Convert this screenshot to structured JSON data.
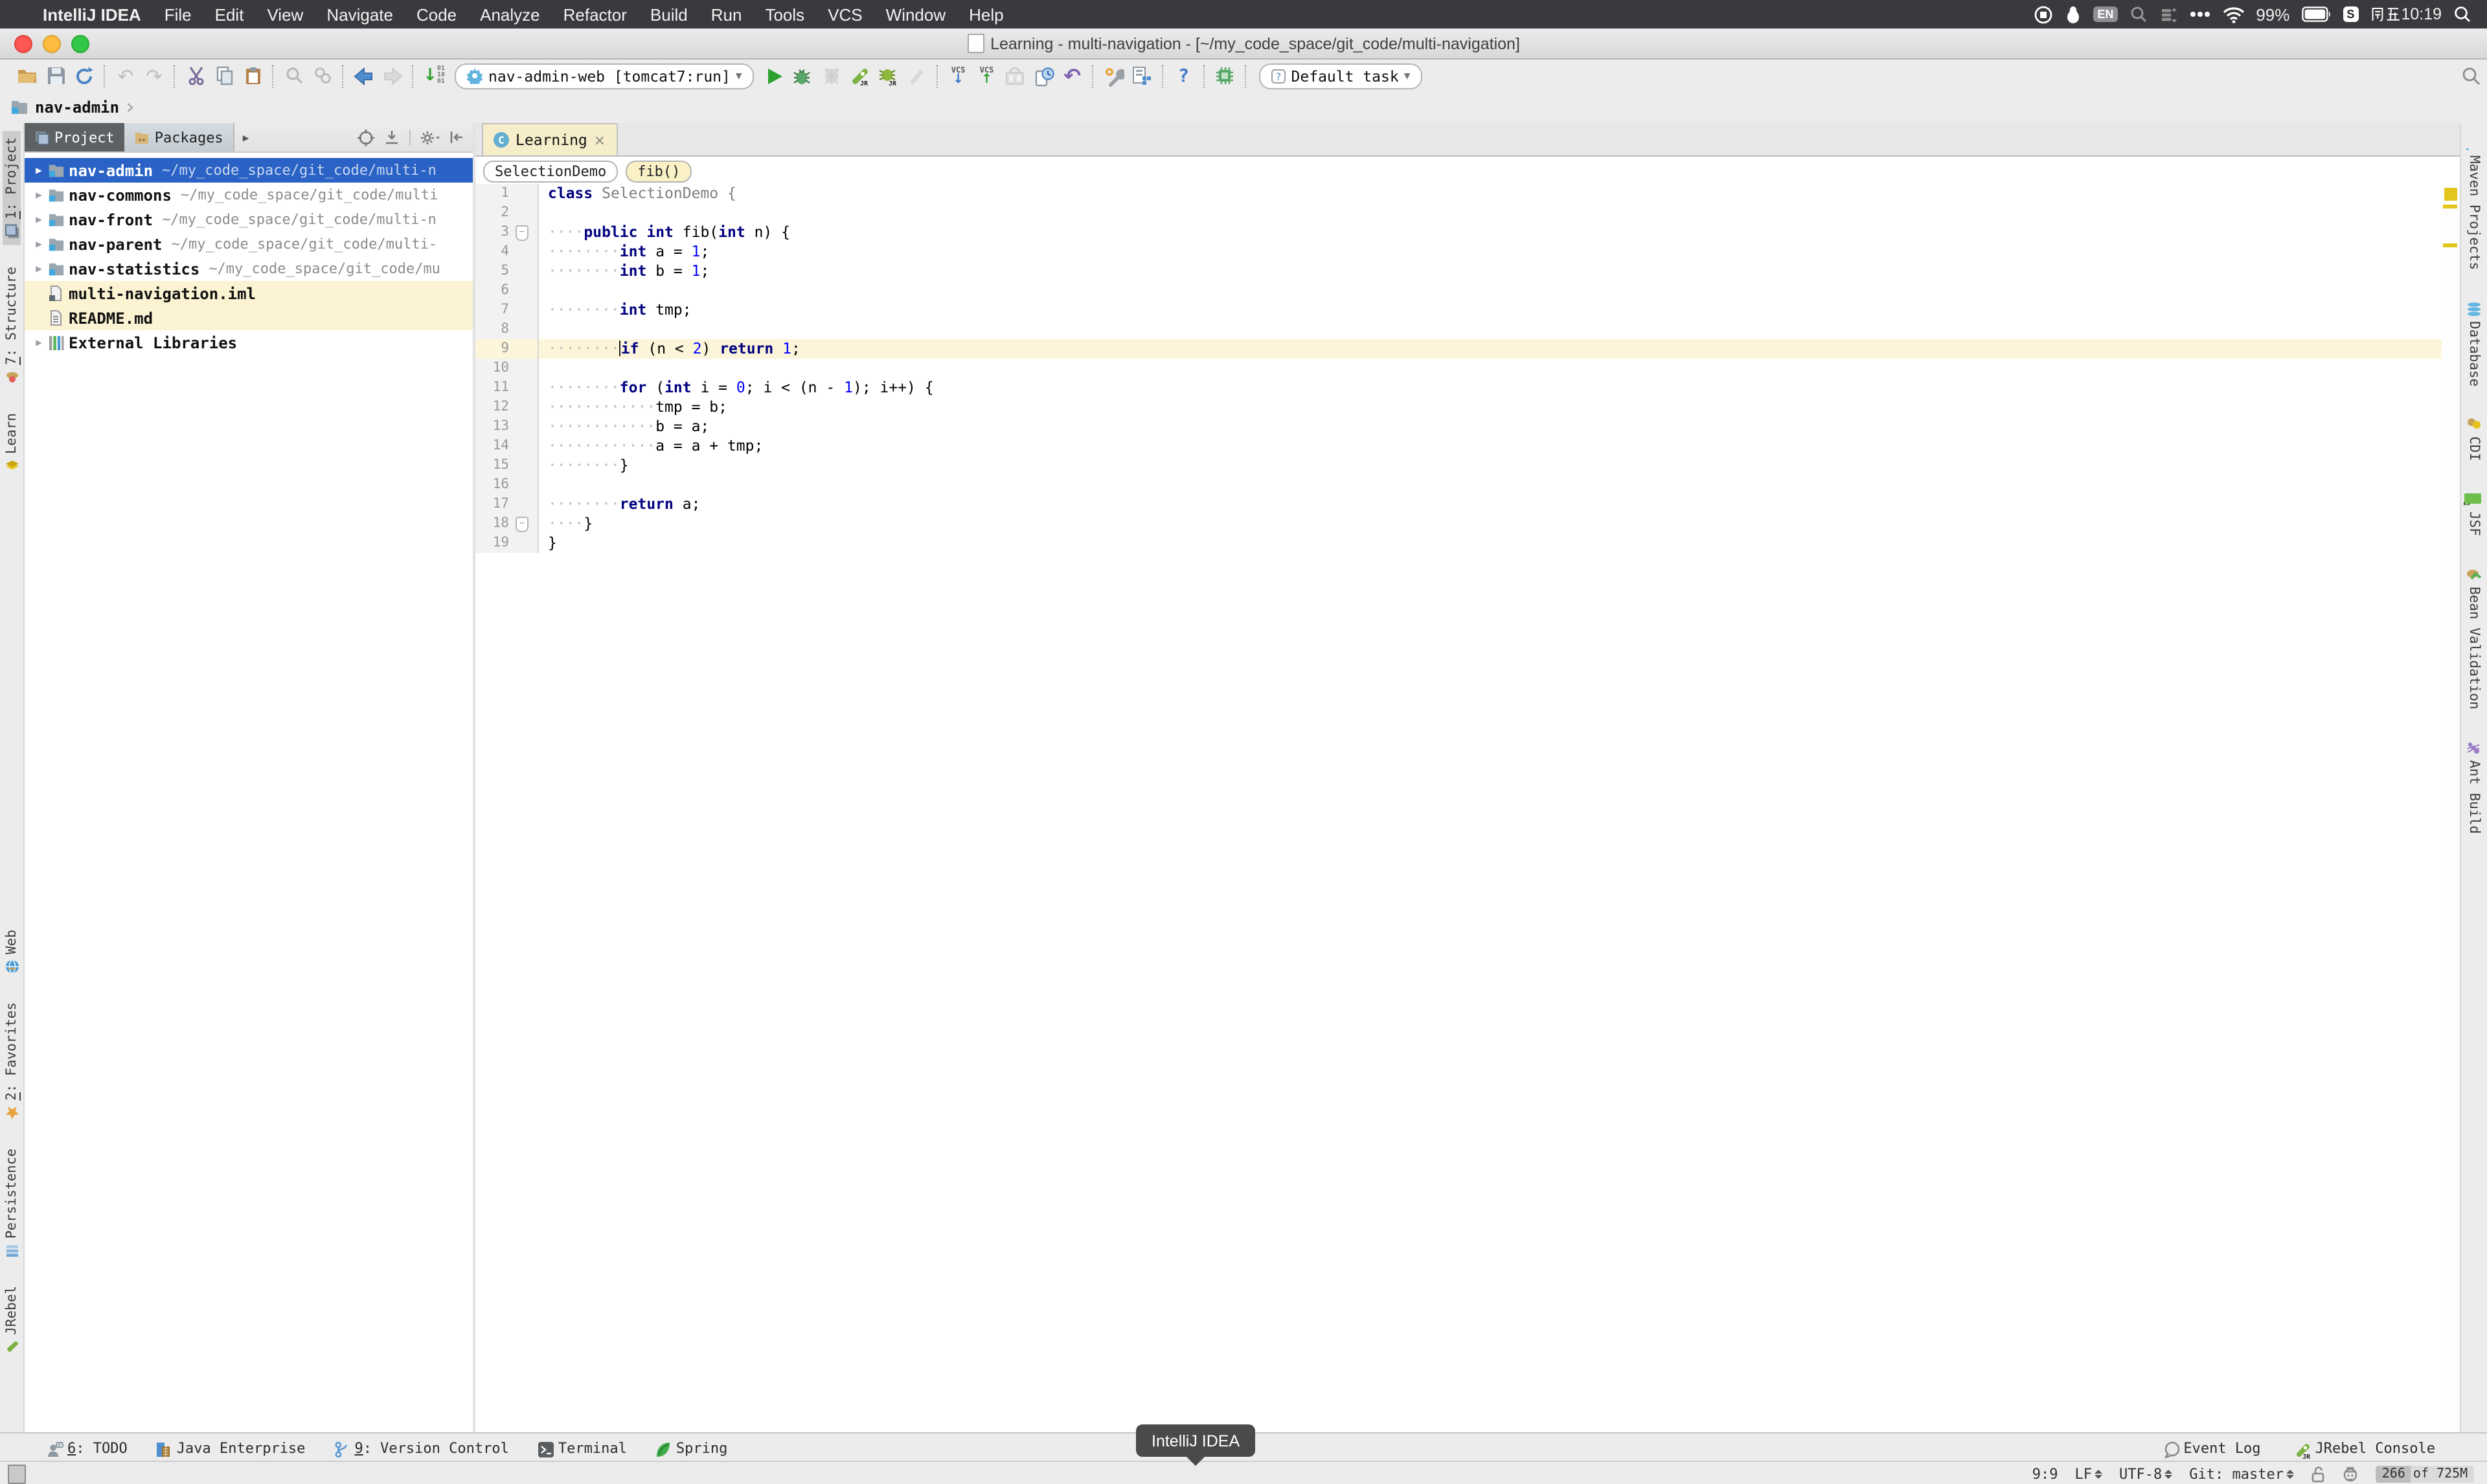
{
  "menubar": {
    "items": [
      "IntelliJ IDEA",
      "File",
      "Edit",
      "View",
      "Navigate",
      "Code",
      "Analyze",
      "Refactor",
      "Build",
      "Run",
      "Tools",
      "VCS",
      "Window",
      "Help"
    ],
    "status": {
      "input_badge": "EN",
      "ime_badge": "S",
      "battery": "99%",
      "clock_day": "周五",
      "clock_time": "10:19",
      "clock_full": "周五10:19"
    }
  },
  "titlebar": {
    "title": "Learning - multi-navigation - [~/my_code_space/git_code/multi-navigation]"
  },
  "toolbar": {
    "run_config": "nav-admin-web [tomcat7:run]",
    "task_config": "Default task",
    "help_label": "?"
  },
  "navbar": {
    "path": "nav-admin"
  },
  "left_stripe": {
    "top": [
      {
        "label": "1: Project",
        "icon": "project-icon",
        "active": true,
        "mnemonic": true
      },
      {
        "label": "7: Structure",
        "icon": "structure-icon",
        "active": false,
        "mnemonic": true
      },
      {
        "label": "Learn",
        "icon": "learn-icon",
        "active": false,
        "mnemonic": false
      }
    ],
    "bottom": [
      {
        "label": "Web",
        "icon": "web-icon",
        "active": false,
        "mnemonic": false
      },
      {
        "label": "2: Favorites",
        "icon": "favorites-icon",
        "active": false,
        "mnemonic": true
      },
      {
        "label": "Persistence",
        "icon": "persistence-icon",
        "active": false,
        "mnemonic": false
      },
      {
        "label": "JRebel",
        "icon": "jrebel-icon",
        "active": false,
        "mnemonic": false
      }
    ]
  },
  "right_stripe": {
    "items": [
      {
        "label": "Maven Projects",
        "icon": "maven-icon"
      },
      {
        "label": "Database",
        "icon": "database-icon"
      },
      {
        "label": "CDI",
        "icon": "cdi-icon"
      },
      {
        "label": "JSF",
        "icon": "jsf-icon"
      },
      {
        "label": "Bean Validation",
        "icon": "bean-icon"
      },
      {
        "label": "Ant Build",
        "icon": "ant-icon"
      }
    ]
  },
  "project_panel": {
    "tabs": {
      "project": "Project",
      "packages": "Packages"
    },
    "tree": [
      {
        "name": "nav-admin",
        "path": "~/my_code_space/git_code/multi-n",
        "icon": "module-folder",
        "arrow": true,
        "selected": true,
        "highlight": false
      },
      {
        "name": "nav-commons",
        "path": "~/my_code_space/git_code/multi",
        "icon": "module-folder",
        "arrow": true,
        "selected": false,
        "highlight": false
      },
      {
        "name": "nav-front",
        "path": "~/my_code_space/git_code/multi-n",
        "icon": "module-folder",
        "arrow": true,
        "selected": false,
        "highlight": false
      },
      {
        "name": "nav-parent",
        "path": "~/my_code_space/git_code/multi-",
        "icon": "module-folder",
        "arrow": true,
        "selected": false,
        "highlight": false
      },
      {
        "name": "nav-statistics",
        "path": "~/my_code_space/git_code/mu",
        "icon": "module-folder",
        "arrow": true,
        "selected": false,
        "highlight": false
      },
      {
        "name": "multi-navigation.iml",
        "path": "",
        "icon": "iml-file",
        "arrow": false,
        "selected": false,
        "highlight": true
      },
      {
        "name": "README.md",
        "path": "",
        "icon": "md-file",
        "arrow": false,
        "selected": false,
        "highlight": true
      },
      {
        "name": "External Libraries",
        "path": "",
        "icon": "ext-lib",
        "arrow": true,
        "selected": false,
        "highlight": false
      }
    ]
  },
  "editor": {
    "tab": {
      "label": "Learning",
      "file_type_badge": "C",
      "close": "×"
    },
    "breadcrumbs": [
      {
        "label": "SelectionDemo",
        "cream": false
      },
      {
        "label": "fib()",
        "cream": true
      }
    ],
    "lines": [
      {
        "n": 1,
        "segs": [
          [
            "class ",
            "kw"
          ],
          [
            "SelectionDemo ",
            "gray"
          ],
          [
            "{",
            "gray"
          ]
        ]
      },
      {
        "n": 2,
        "segs": []
      },
      {
        "n": 3,
        "fold": "open",
        "segs": [
          [
            "····",
            "ws"
          ],
          [
            "public ",
            "kw"
          ],
          [
            "int ",
            "kw"
          ],
          [
            "fib(",
            "pl"
          ],
          [
            "int ",
            "kw"
          ],
          [
            "n) {",
            "pl"
          ]
        ]
      },
      {
        "n": 4,
        "segs": [
          [
            "········",
            "ws"
          ],
          [
            "int ",
            "kw"
          ],
          [
            "a = ",
            "pl"
          ],
          [
            "1",
            "num"
          ],
          [
            ";",
            "pl"
          ]
        ]
      },
      {
        "n": 5,
        "segs": [
          [
            "········",
            "ws"
          ],
          [
            "int ",
            "kw"
          ],
          [
            "b = ",
            "pl"
          ],
          [
            "1",
            "num"
          ],
          [
            ";",
            "pl"
          ]
        ]
      },
      {
        "n": 6,
        "segs": []
      },
      {
        "n": 7,
        "segs": [
          [
            "········",
            "ws"
          ],
          [
            "int ",
            "kw"
          ],
          [
            "tmp;",
            "pl"
          ]
        ]
      },
      {
        "n": 8,
        "segs": []
      },
      {
        "n": 9,
        "hl": true,
        "caret": true,
        "segs": [
          [
            "········",
            "ws"
          ],
          [
            "if ",
            "kw"
          ],
          [
            "(n < ",
            "pl"
          ],
          [
            "2",
            "num"
          ],
          [
            ") ",
            "pl"
          ],
          [
            "return ",
            "kw"
          ],
          [
            "1",
            "num"
          ],
          [
            ";",
            "pl"
          ]
        ]
      },
      {
        "n": 10,
        "segs": []
      },
      {
        "n": 11,
        "segs": [
          [
            "········",
            "ws"
          ],
          [
            "for ",
            "kw"
          ],
          [
            "(",
            "pl"
          ],
          [
            "int ",
            "kw"
          ],
          [
            "i = ",
            "pl"
          ],
          [
            "0",
            "num"
          ],
          [
            "; i < (n - ",
            "pl"
          ],
          [
            "1",
            "num"
          ],
          [
            "); i++) {",
            "pl"
          ]
        ]
      },
      {
        "n": 12,
        "segs": [
          [
            "············",
            "ws"
          ],
          [
            "tmp = b;",
            "pl"
          ]
        ]
      },
      {
        "n": 13,
        "segs": [
          [
            "············",
            "ws"
          ],
          [
            "b = a;",
            "pl"
          ]
        ]
      },
      {
        "n": 14,
        "segs": [
          [
            "············",
            "ws"
          ],
          [
            "a = a + tmp;",
            "pl"
          ]
        ]
      },
      {
        "n": 15,
        "segs": [
          [
            "········",
            "ws"
          ],
          [
            "}",
            "pl"
          ]
        ]
      },
      {
        "n": 16,
        "segs": []
      },
      {
        "n": 17,
        "segs": [
          [
            "········",
            "ws"
          ],
          [
            "return ",
            "kw"
          ],
          [
            "a;",
            "pl"
          ]
        ]
      },
      {
        "n": 18,
        "fold": "end",
        "segs": [
          [
            "····",
            "ws"
          ],
          [
            "}",
            "pl"
          ]
        ]
      },
      {
        "n": 19,
        "segs": [
          [
            "}",
            "pl"
          ]
        ]
      }
    ]
  },
  "bottom_bar": {
    "items": [
      {
        "label": "6: TODO",
        "icon": "todo-icon",
        "mnemonic": true
      },
      {
        "label": "Java Enterprise",
        "icon": "javaee-icon",
        "mnemonic": false
      },
      {
        "label": "9: Version Control",
        "icon": "vcontrol-icon",
        "mnemonic": true
      },
      {
        "label": "Terminal",
        "icon": "terminal-icon",
        "mnemonic": false
      },
      {
        "label": "Spring",
        "icon": "spring-icon",
        "mnemonic": false
      }
    ],
    "right_items": [
      {
        "label": "Event Log",
        "icon": "event-log-icon",
        "mnemonic": false
      },
      {
        "label": "JRebel Console",
        "icon": "jrebel-console-icon",
        "mnemonic": false
      }
    ]
  },
  "tooltip": {
    "text": "IntelliJ IDEA"
  },
  "statusbar": {
    "position": "9:9",
    "line_separator": "LF",
    "encoding": "UTF-8",
    "vcs": "Git: master",
    "memory_text": "266 of 725M"
  }
}
